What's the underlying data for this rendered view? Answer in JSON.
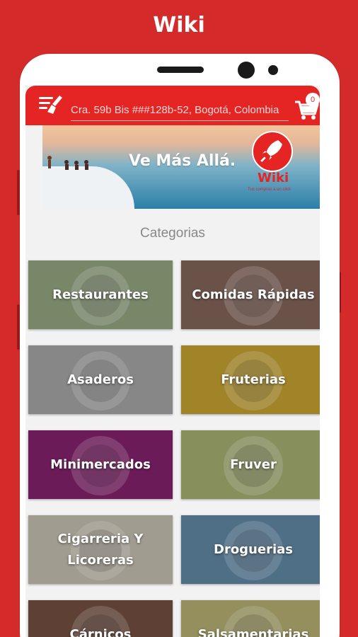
{
  "promo": {
    "title": "Wiki"
  },
  "appbar": {
    "address_value": "Cra. 59b Bis ###128b-52, Bogotá, Colombia",
    "cart_count": "0",
    "accent": "#e52424"
  },
  "banner": {
    "slogan": "Ve Más Allá.",
    "logo_text": "Wiki",
    "tagline": "Tus compras a un click"
  },
  "section": {
    "title": "Categorias"
  },
  "categories": [
    {
      "label": "Restaurantes",
      "color": "#8a9a78",
      "icon": "chef-plate-icon"
    },
    {
      "label": "Comidas Rápidas",
      "color": "#7a5e54",
      "icon": "burger-icon"
    },
    {
      "label": "Asaderos",
      "color": "#9a9a9a",
      "icon": "rooster-icon"
    },
    {
      "label": "Fruterias",
      "color": "#b8962e",
      "icon": "watermelon-icon"
    },
    {
      "label": "Minimercados",
      "color": "#7c1f66",
      "icon": "shopping-basket-icon"
    },
    {
      "label": "Fruver",
      "color": "#9aa36a",
      "icon": "vegetables-icon"
    },
    {
      "label": "Cigarreria Y\nLicoreras",
      "color": "#b8b2a4",
      "icon": "liquor-bottles-icon"
    },
    {
      "label": "Droguerias",
      "color": "#5a7f9a",
      "icon": "pharmacy-pin-icon"
    },
    {
      "label": "Cárnicos",
      "color": "#6b4a3c",
      "icon": "meat-icon"
    },
    {
      "label": "Salsamentarias",
      "color": "#a9a36a",
      "icon": "sausage-icon"
    }
  ]
}
